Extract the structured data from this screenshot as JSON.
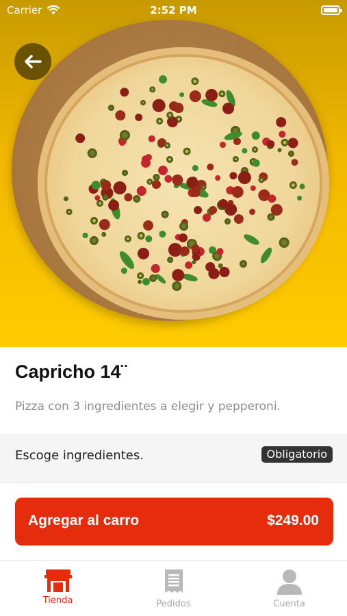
{
  "status_bar": {
    "carrier": "Carrier",
    "time": "2:52 PM"
  },
  "product": {
    "title": "Capricho 14¨",
    "description": "Pizza con 3 ingredientes a elegir y pepperoni.",
    "price": "$249.00"
  },
  "options": {
    "label": "Escoge ingredientes.",
    "badge": "Obligatorio"
  },
  "cta": {
    "label": "Agregar al carro"
  },
  "tabs": [
    {
      "label": "Tienda",
      "icon": "store-icon",
      "active": true
    },
    {
      "label": "Pedidos",
      "icon": "receipt-icon",
      "active": false
    },
    {
      "label": "Cuenta",
      "icon": "user-icon",
      "active": false
    }
  ],
  "colors": {
    "accent": "#e52d0d",
    "hero_bg": "#ffcb00",
    "badge_bg": "#333333"
  }
}
